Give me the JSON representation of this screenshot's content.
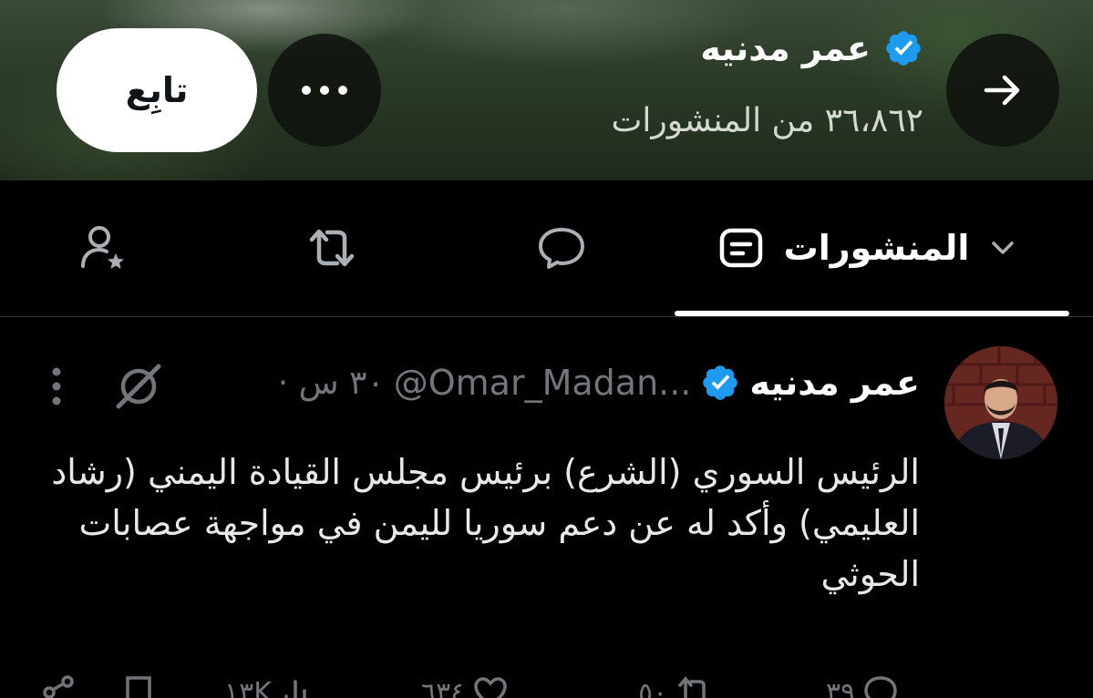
{
  "header": {
    "profile_name": "عمر مدنيه",
    "post_count": "٣٦،٨٦٢ من المنشورات",
    "follow_label": "تابِع",
    "more_label": "•••"
  },
  "tabs": [
    {
      "label": "المنشورات",
      "icon": "posts-icon",
      "active": true
    },
    {
      "label": "",
      "icon": "replies-icon"
    },
    {
      "label": "",
      "icon": "reposts-icon"
    },
    {
      "label": "",
      "icon": "person-star-icon"
    }
  ],
  "post": {
    "author": "عمر مدنيه",
    "handle": "@Omar_Madan...",
    "time": "٣٠ س ·",
    "text": "الرئيس السوري (الشرع) برئيس مجلس القيادة اليمني (رشاد العليمي) وأكد له عن دعم سوريا لليمن في مواجهة عصابات الحوثي",
    "actions": {
      "replies": "٣٩",
      "reposts": "٥٠",
      "likes": "٦٣٤",
      "views": "١٣K"
    }
  },
  "colors": {
    "verified": "#1d9bf0",
    "muted": "#71767b",
    "text": "#e7e9ea",
    "background": "#000000"
  }
}
